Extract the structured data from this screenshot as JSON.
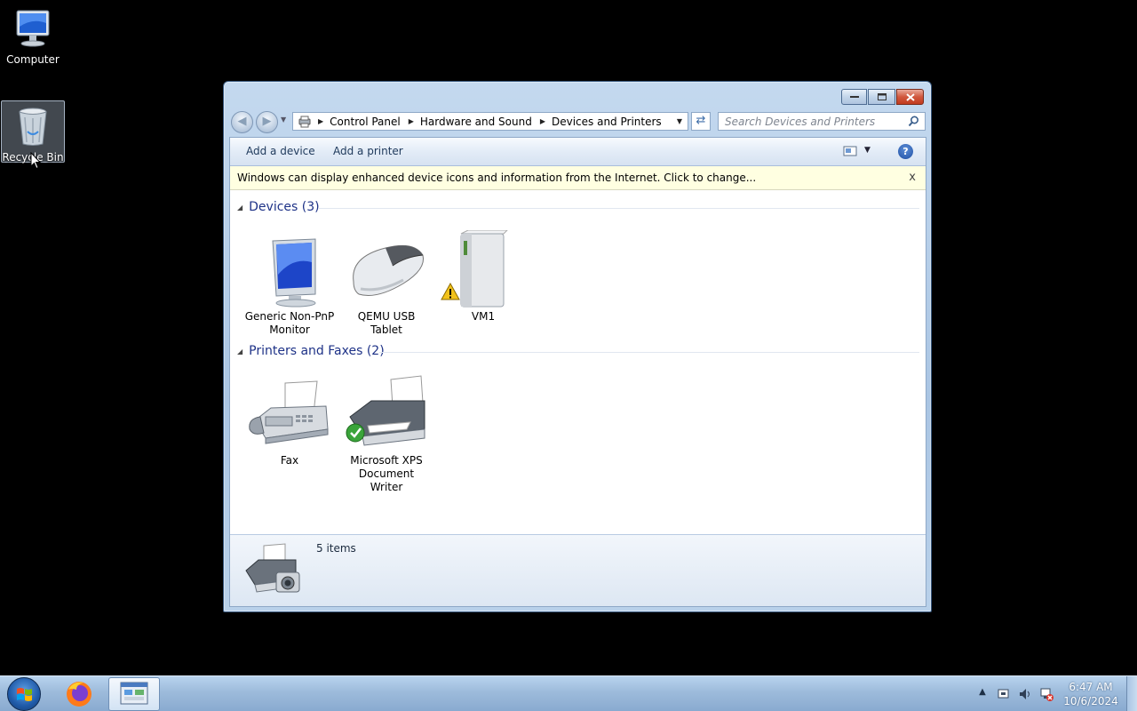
{
  "desktop": {
    "icons": [
      {
        "label": "Computer"
      },
      {
        "label": "Recycle Bin"
      }
    ]
  },
  "window": {
    "breadcrumb": [
      "Control Panel",
      "Hardware and Sound",
      "Devices and Printers"
    ],
    "search_placeholder": "Search Devices and Printers",
    "toolbar": {
      "add_device": "Add a device",
      "add_printer": "Add a printer"
    },
    "infobar": {
      "text": "Windows can display enhanced device icons and information from the Internet. Click to change...",
      "close": "x"
    },
    "groups": {
      "devices": {
        "title": "Devices (3)",
        "items": [
          {
            "label_line1": "Generic Non-PnP",
            "label_line2": "Monitor"
          },
          {
            "label_line1": "QEMU USB",
            "label_line2": "Tablet"
          },
          {
            "label_line1": "VM1",
            "label_line2": ""
          }
        ]
      },
      "printers": {
        "title": "Printers and Faxes (2)",
        "items": [
          {
            "label_line1": "Fax",
            "label_line2": ""
          },
          {
            "label_line1": "Microsoft XPS",
            "label_line2": "Document Writer"
          }
        ]
      }
    },
    "details": {
      "count": "5 items"
    }
  },
  "taskbar": {
    "clock_time": "6:47 AM",
    "clock_date": "10/6/2024"
  },
  "colors": {
    "group_header": "#1e3287",
    "infobar_bg": "#ffffe1",
    "toolbar_text": "#1e395b"
  }
}
